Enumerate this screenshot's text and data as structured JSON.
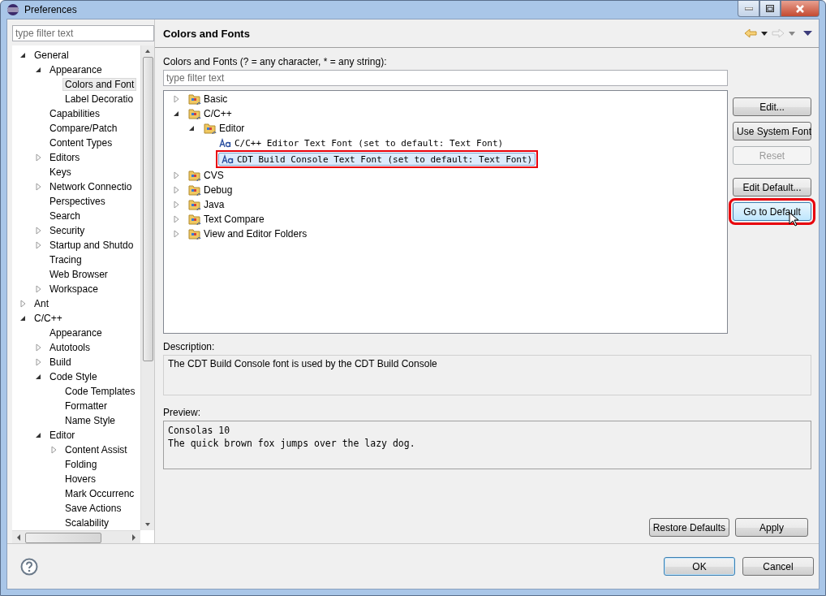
{
  "window": {
    "title": "Preferences"
  },
  "sidebar": {
    "filter": {
      "placeholder": "type filter text"
    },
    "items": [
      {
        "label": "General",
        "expanded": true,
        "selected": false,
        "children": [
          {
            "label": "Appearance",
            "expanded": true,
            "selected": false,
            "children": [
              {
                "label": "Colors and Font",
                "selected": true
              },
              {
                "label": "Label Decoratio",
                "selected": false
              }
            ]
          },
          {
            "label": "Capabilities",
            "selected": false
          },
          {
            "label": "Compare/Patch",
            "selected": false
          },
          {
            "label": "Content Types",
            "selected": false
          },
          {
            "label": "Editors",
            "expanded": false,
            "selected": false
          },
          {
            "label": "Keys",
            "selected": false
          },
          {
            "label": "Network Connectio",
            "expanded": false,
            "selected": false
          },
          {
            "label": "Perspectives",
            "selected": false
          },
          {
            "label": "Search",
            "selected": false
          },
          {
            "label": "Security",
            "expanded": false,
            "selected": false
          },
          {
            "label": "Startup and Shutdo",
            "expanded": false,
            "selected": false
          },
          {
            "label": "Tracing",
            "selected": false
          },
          {
            "label": "Web Browser",
            "selected": false
          },
          {
            "label": "Workspace",
            "expanded": false,
            "selected": false
          }
        ]
      },
      {
        "label": "Ant",
        "expanded": false,
        "selected": false
      },
      {
        "label": "C/C++",
        "expanded": true,
        "selected": false,
        "children": [
          {
            "label": "Appearance",
            "selected": false
          },
          {
            "label": "Autotools",
            "expanded": false,
            "selected": false
          },
          {
            "label": "Build",
            "expanded": false,
            "selected": false
          },
          {
            "label": "Code Style",
            "expanded": true,
            "selected": false,
            "children": [
              {
                "label": "Code Templates",
                "selected": false
              },
              {
                "label": "Formatter",
                "selected": false
              },
              {
                "label": "Name Style",
                "selected": false
              }
            ]
          },
          {
            "label": "Editor",
            "expanded": true,
            "selected": false,
            "children": [
              {
                "label": "Content Assist",
                "expanded": false,
                "selected": false
              },
              {
                "label": "Folding",
                "selected": false
              },
              {
                "label": "Hovers",
                "selected": false
              },
              {
                "label": "Mark Occurrenc",
                "selected": false
              },
              {
                "label": "Save Actions",
                "selected": false
              },
              {
                "label": "Scalability",
                "selected": false
              }
            ]
          }
        ]
      }
    ]
  },
  "page": {
    "title": "Colors and Fonts",
    "filter_label": "Colors and Fonts (? = any character, * = any string):",
    "filter": {
      "placeholder": "type filter text"
    },
    "tree": [
      {
        "label": "Basic",
        "kind": "folder",
        "expanded": false,
        "selected": false,
        "highlighted": false
      },
      {
        "label": "C/C++",
        "kind": "folder",
        "expanded": true,
        "selected": false,
        "highlighted": false,
        "children": [
          {
            "label": "Editor",
            "kind": "folder",
            "expanded": true,
            "selected": false,
            "highlighted": false,
            "children": [
              {
                "label": "C/C++ Editor Text Font (set to default: Text Font)",
                "kind": "font",
                "selected": false,
                "highlighted": false
              },
              {
                "label": "CDT Build Console Text Font (set to default: Text Font)",
                "kind": "font",
                "selected": true,
                "highlighted": true
              }
            ]
          }
        ]
      },
      {
        "label": "CVS",
        "kind": "folder",
        "expanded": false,
        "selected": false,
        "highlighted": false
      },
      {
        "label": "Debug",
        "kind": "folder",
        "expanded": false,
        "selected": false,
        "highlighted": false
      },
      {
        "label": "Java",
        "kind": "folder",
        "expanded": false,
        "selected": false,
        "highlighted": false
      },
      {
        "label": "Text Compare",
        "kind": "folder",
        "expanded": false,
        "selected": false,
        "highlighted": false
      },
      {
        "label": "View and Editor Folders",
        "kind": "folder",
        "expanded": false,
        "selected": false,
        "highlighted": false
      }
    ],
    "font_buttons": [
      {
        "label": "Edit...",
        "disabled": false,
        "highlighted": false,
        "hovered": false
      },
      {
        "label": "Use System Font",
        "disabled": false,
        "highlighted": false,
        "hovered": false
      },
      {
        "label": "Reset",
        "disabled": true,
        "highlighted": false,
        "hovered": false
      }
    ],
    "default_buttons": [
      {
        "label": "Edit Default...",
        "disabled": false,
        "highlighted": false,
        "hovered": false
      },
      {
        "label": "Go to Default",
        "disabled": false,
        "highlighted": true,
        "hovered": true
      }
    ],
    "description_label": "Description:",
    "description": "The CDT Build Console font is used by the CDT Build Console",
    "preview_label": "Preview:",
    "preview_lines": [
      "Consolas 10",
      "The quick brown fox jumps over the lazy dog."
    ],
    "page_buttons": [
      "Restore Defaults",
      "Apply"
    ]
  },
  "dialog_buttons": [
    {
      "label": "OK",
      "default": true
    },
    {
      "label": "Cancel",
      "default": false
    }
  ]
}
